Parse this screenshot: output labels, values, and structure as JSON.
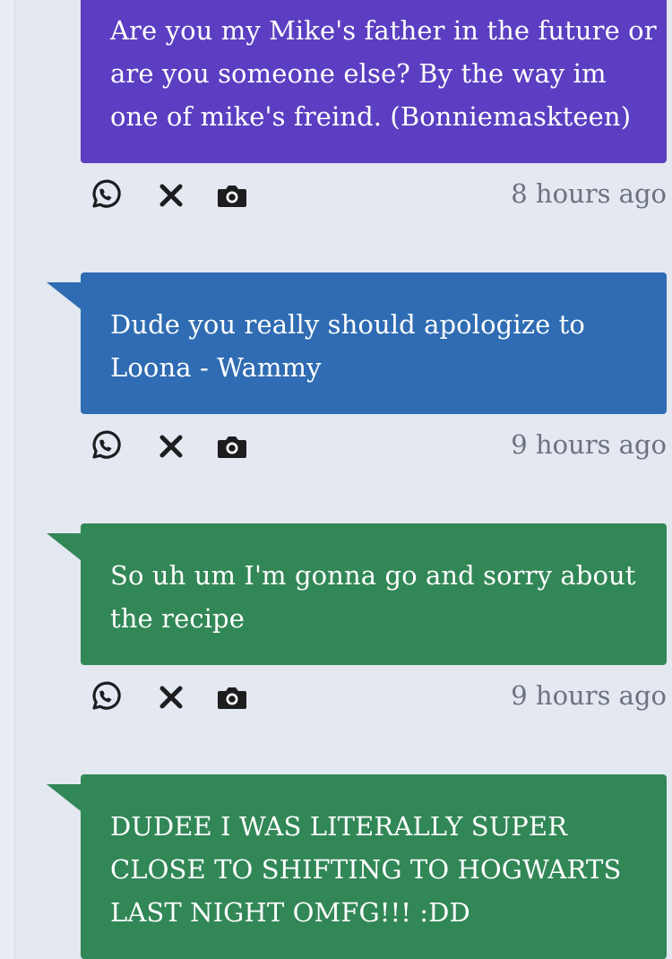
{
  "colors": {
    "background": "#e3e8f1",
    "purple": "#5b3ec1",
    "blue": "#2f6cb3",
    "green": "#328757",
    "timestamp": "#6d7280"
  },
  "messages": [
    {
      "text": "Are you my Mike's father in the future or are you someone else? By the way im one of mike's freind. (Bonniemaskteen)",
      "color": "#5b3ec1",
      "time": "8 hours ago",
      "actions": [
        "whatsapp-icon",
        "close-icon",
        "camera-icon"
      ]
    },
    {
      "text": "Dude you really should apologize to Loona - Wammy",
      "color": "#2f6cb3",
      "time": "9 hours ago",
      "actions": [
        "whatsapp-icon",
        "close-icon",
        "camera-icon"
      ]
    },
    {
      "text": "So uh um I'm gonna go and sorry about the recipe",
      "color": "#328757",
      "time": "9 hours ago",
      "actions": [
        "whatsapp-icon",
        "close-icon",
        "camera-icon"
      ]
    },
    {
      "text": "DUDEE I WAS LITERALLY SUPER CLOSE TO SHIFTING TO HOGWARTS LAST NIGHT OMFG!!! :DD",
      "color": "#328757"
    }
  ]
}
